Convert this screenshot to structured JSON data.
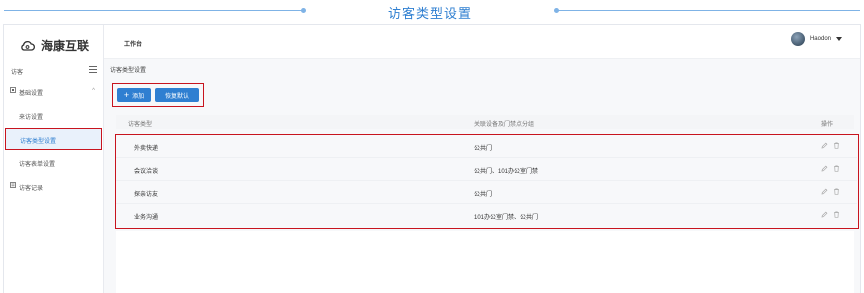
{
  "banner": {
    "title": "访客类型设置"
  },
  "logo": {
    "text": "海康互联",
    "icon": "cloud-logo-icon"
  },
  "sidebar": {
    "section": "访客",
    "items": [
      {
        "label": "基础设置",
        "icon": "settings-icon",
        "expanded": true
      },
      {
        "label": "来访设置"
      },
      {
        "label": "访客类型设置",
        "active": true
      },
      {
        "label": "访客表单设置"
      },
      {
        "label": "访客记录",
        "icon": "record-icon"
      }
    ]
  },
  "topbar": {
    "breadcrumb": "工作台",
    "user": "Haodon"
  },
  "content": {
    "section_title": "访客类型设置",
    "buttons": {
      "add": "添加",
      "reset": "恢复默认"
    },
    "columns": [
      "访客类型",
      "关联设备及门禁点分组",
      "操作"
    ],
    "rows": [
      {
        "type": "外卖快递",
        "group": "公共门"
      },
      {
        "type": "会议洽谈",
        "group": "公共门、101办公室门禁"
      },
      {
        "type": "探亲访友",
        "group": "公共门"
      },
      {
        "type": "业务沟通",
        "group": "101办公室门禁、公共门"
      }
    ]
  },
  "colors": {
    "accent": "#2f7fd1",
    "highlight": "#c8141e",
    "active_bg": "#e9f1fb"
  }
}
